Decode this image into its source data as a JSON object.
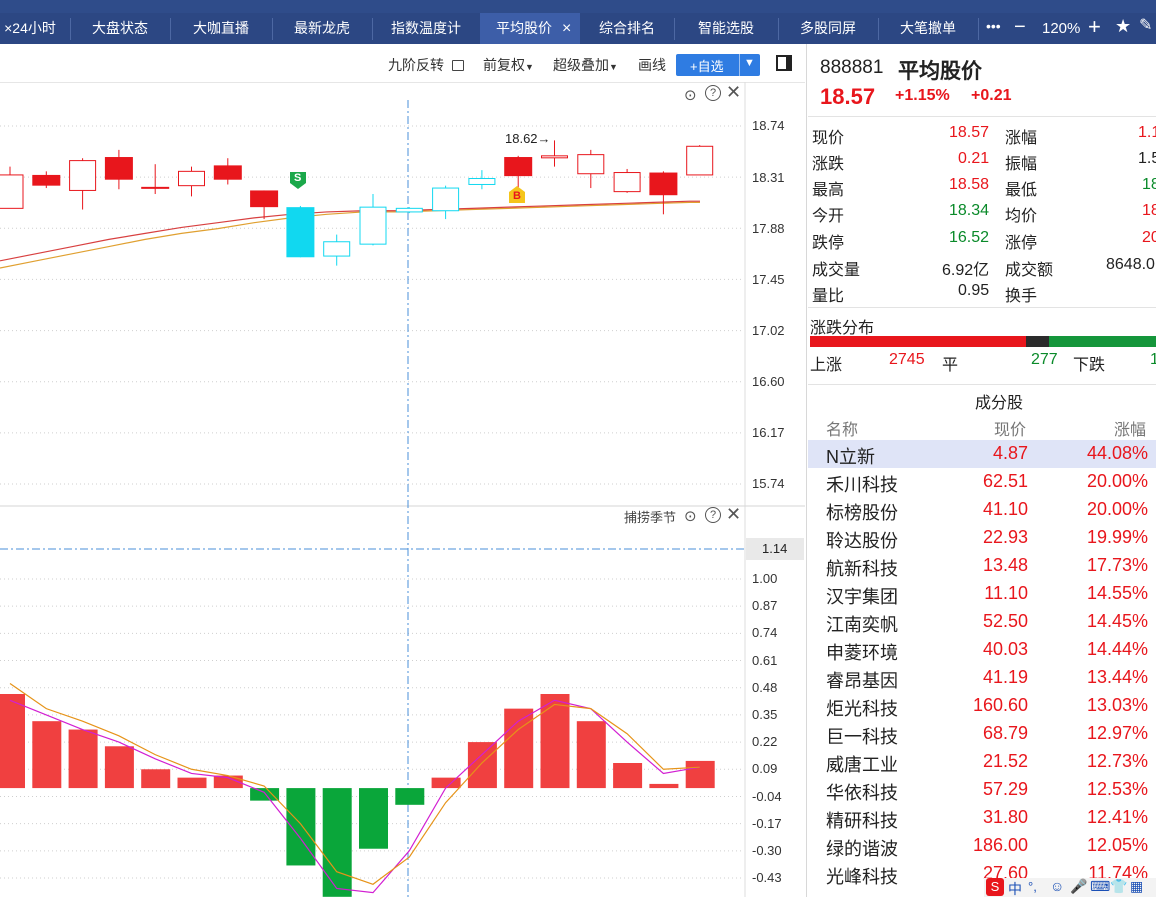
{
  "top_tabs": [
    {
      "label": "×24小时"
    },
    {
      "label": "大盘状态"
    },
    {
      "label": "大咖直播"
    },
    {
      "label": "最新龙虎"
    },
    {
      "label": "指数温度计"
    },
    {
      "label": "平均股价",
      "close": "×"
    },
    {
      "label": "综合排名"
    },
    {
      "label": "智能选股"
    },
    {
      "label": "多股同屏"
    },
    {
      "label": "大笔撤单"
    }
  ],
  "top_right": {
    "more": "•••",
    "zoom_minus": "−",
    "zoom": "120%",
    "zoom_plus": "+",
    "star": "★"
  },
  "toolbar": {
    "nine_turn": "九阶反转",
    "fq": "前复权",
    "overlay": "超级叠加",
    "draw": "画线",
    "add": "+自选"
  },
  "chart": {
    "price_ticks": [
      "18.74",
      "18.31",
      "17.88",
      "17.45",
      "17.02",
      "16.60",
      "16.17",
      "15.74"
    ],
    "max_marker": "18.62→",
    "sell_badge": "S",
    "buy_badge": "B",
    "candles": [
      {
        "o": 18.05,
        "c": 18.33,
        "h": 18.4,
        "l": 18.05
      },
      {
        "o": 18.24,
        "c": 18.33,
        "h": 18.36,
        "l": 18.22
      },
      {
        "o": 18.2,
        "c": 18.45,
        "h": 18.47,
        "l": 18.04
      },
      {
        "o": 18.48,
        "c": 18.29,
        "h": 18.54,
        "l": 18.21
      },
      {
        "o": 18.23,
        "c": 18.23,
        "h": 18.42,
        "l": 18.17
      },
      {
        "o": 18.24,
        "c": 18.36,
        "h": 18.4,
        "l": 18.15
      },
      {
        "o": 18.41,
        "c": 18.29,
        "h": 18.47,
        "l": 18.25
      },
      {
        "o": 18.2,
        "c": 18.06,
        "h": 18.2,
        "l": 17.96
      },
      {
        "o": 18.06,
        "c": 17.64,
        "h": 18.07,
        "l": 17.64
      },
      {
        "o": 17.65,
        "c": 17.77,
        "h": 17.83,
        "l": 17.57
      },
      {
        "o": 17.75,
        "c": 18.06,
        "h": 18.17,
        "l": 17.74
      },
      {
        "o": 18.02,
        "c": 18.05,
        "h": 18.06,
        "l": 18.01
      },
      {
        "o": 18.03,
        "c": 18.22,
        "h": 18.24,
        "l": 17.96
      },
      {
        "o": 18.25,
        "c": 18.3,
        "h": 18.37,
        "l": 18.21
      },
      {
        "o": 18.32,
        "c": 18.48,
        "h": 18.49,
        "l": 18.21
      },
      {
        "o": 18.49,
        "c": 18.49,
        "h": 18.62,
        "l": 18.4
      },
      {
        "o": 18.34,
        "c": 18.5,
        "h": 18.54,
        "l": 18.22
      },
      {
        "o": 18.19,
        "c": 18.35,
        "h": 18.38,
        "l": 18.18
      },
      {
        "o": 18.35,
        "c": 18.16,
        "h": 18.36,
        "l": 18.0
      },
      {
        "o": 18.33,
        "c": 18.57,
        "h": 18.58,
        "l": 18.34
      }
    ],
    "ma1": [
      17.55,
      17.61,
      17.67,
      17.73,
      17.79,
      17.84,
      17.88,
      17.93,
      17.97,
      18.0,
      18.02,
      18.02,
      18.03,
      18.04,
      18.05,
      18.06,
      18.07,
      18.08,
      18.09,
      18.1
    ],
    "ma2": [
      17.61,
      17.67,
      17.73,
      17.79,
      17.84,
      17.89,
      17.93,
      17.97,
      18.0,
      18.02,
      18.03,
      18.03,
      18.04,
      18.05,
      18.06,
      18.07,
      18.08,
      18.09,
      18.1,
      18.11
    ],
    "ind_title": "捕捞季节",
    "ind_current": "1.14",
    "ind_ticks": [
      "1.00",
      "0.87",
      "0.74",
      "0.61",
      "0.48",
      "0.35",
      "0.22",
      "0.09",
      "-0.04",
      "-0.17",
      "-0.30",
      "-0.43"
    ],
    "ind_bars": [
      0.45,
      0.32,
      0.28,
      0.2,
      0.09,
      0.05,
      0.06,
      -0.06,
      -0.37,
      -0.52,
      -0.29,
      -0.08,
      0.05,
      0.22,
      0.38,
      0.45,
      0.32,
      0.12,
      0.02,
      0.13
    ],
    "ind_line1": [
      0.42,
      0.35,
      0.28,
      0.22,
      0.14,
      0.07,
      0.05,
      -0.02,
      -0.24,
      -0.48,
      -0.5,
      -0.3,
      0.0,
      0.16,
      0.32,
      0.42,
      0.38,
      0.22,
      0.07,
      0.1
    ],
    "ind_line2": [
      0.5,
      0.38,
      0.32,
      0.25,
      0.16,
      0.09,
      0.06,
      0.01,
      -0.17,
      -0.4,
      -0.46,
      -0.33,
      -0.07,
      0.12,
      0.28,
      0.4,
      0.38,
      0.26,
      0.09,
      0.1
    ]
  },
  "quote": {
    "code": "888881",
    "name": "平均股价",
    "price": "18.57",
    "pct": "+1.15%",
    "chg": "+0.21",
    "fields": [
      {
        "label": "现价",
        "value": "18.57",
        "label2": "涨幅",
        "value2": "1.1"
      },
      {
        "label": "涨跌",
        "value": "0.21",
        "label2": "振幅",
        "value2": "1.5"
      },
      {
        "label": "最高",
        "value": "18.58",
        "label2": "最低",
        "value2": "18"
      },
      {
        "label": "今开",
        "value": "18.34",
        "label2": "均价",
        "value2": "18"
      },
      {
        "label": "跌停",
        "value": "16.52",
        "label2": "涨停",
        "value2": "20"
      },
      {
        "label": "成交量",
        "value": "6.92亿",
        "label2": "成交额",
        "value2": "8648.0"
      },
      {
        "label": "量比",
        "value": "0.95",
        "label2": "换手",
        "value2": ""
      }
    ],
    "dist_title": "涨跌分布",
    "up_label": "上涨",
    "up": "2745",
    "flat_label": "平",
    "flat": "277",
    "down_label": "下跌",
    "down": "1"
  },
  "components": {
    "title": "成分股",
    "headers": [
      "名称",
      "现价",
      "涨幅"
    ],
    "rows": [
      {
        "name": "N立新",
        "price": "4.87",
        "pct": "44.08%"
      },
      {
        "name": "禾川科技",
        "price": "62.51",
        "pct": "20.00%"
      },
      {
        "name": "标榜股份",
        "price": "41.10",
        "pct": "20.00%"
      },
      {
        "name": "聆达股份",
        "price": "22.93",
        "pct": "19.99%"
      },
      {
        "name": "航新科技",
        "price": "13.48",
        "pct": "17.73%"
      },
      {
        "name": "汉宇集团",
        "price": "11.10",
        "pct": "14.55%"
      },
      {
        "name": "江南奕帆",
        "price": "52.50",
        "pct": "14.45%"
      },
      {
        "name": "申菱环境",
        "price": "40.03",
        "pct": "14.44%"
      },
      {
        "name": "睿昂基因",
        "price": "41.19",
        "pct": "13.44%"
      },
      {
        "name": "炬光科技",
        "price": "160.60",
        "pct": "13.03%"
      },
      {
        "name": "巨一科技",
        "price": "68.79",
        "pct": "12.97%"
      },
      {
        "name": "威唐工业",
        "price": "21.52",
        "pct": "12.73%"
      },
      {
        "name": "华依科技",
        "price": "57.29",
        "pct": "12.53%"
      },
      {
        "name": "精研科技",
        "price": "31.80",
        "pct": "12.41%"
      },
      {
        "name": "绿的谐波",
        "price": "186.00",
        "pct": "12.05%"
      },
      {
        "name": "光峰科技",
        "price": "27.60",
        "pct": "11.74%"
      }
    ]
  },
  "tray": {
    "ime": "中",
    "punct": "°,"
  }
}
